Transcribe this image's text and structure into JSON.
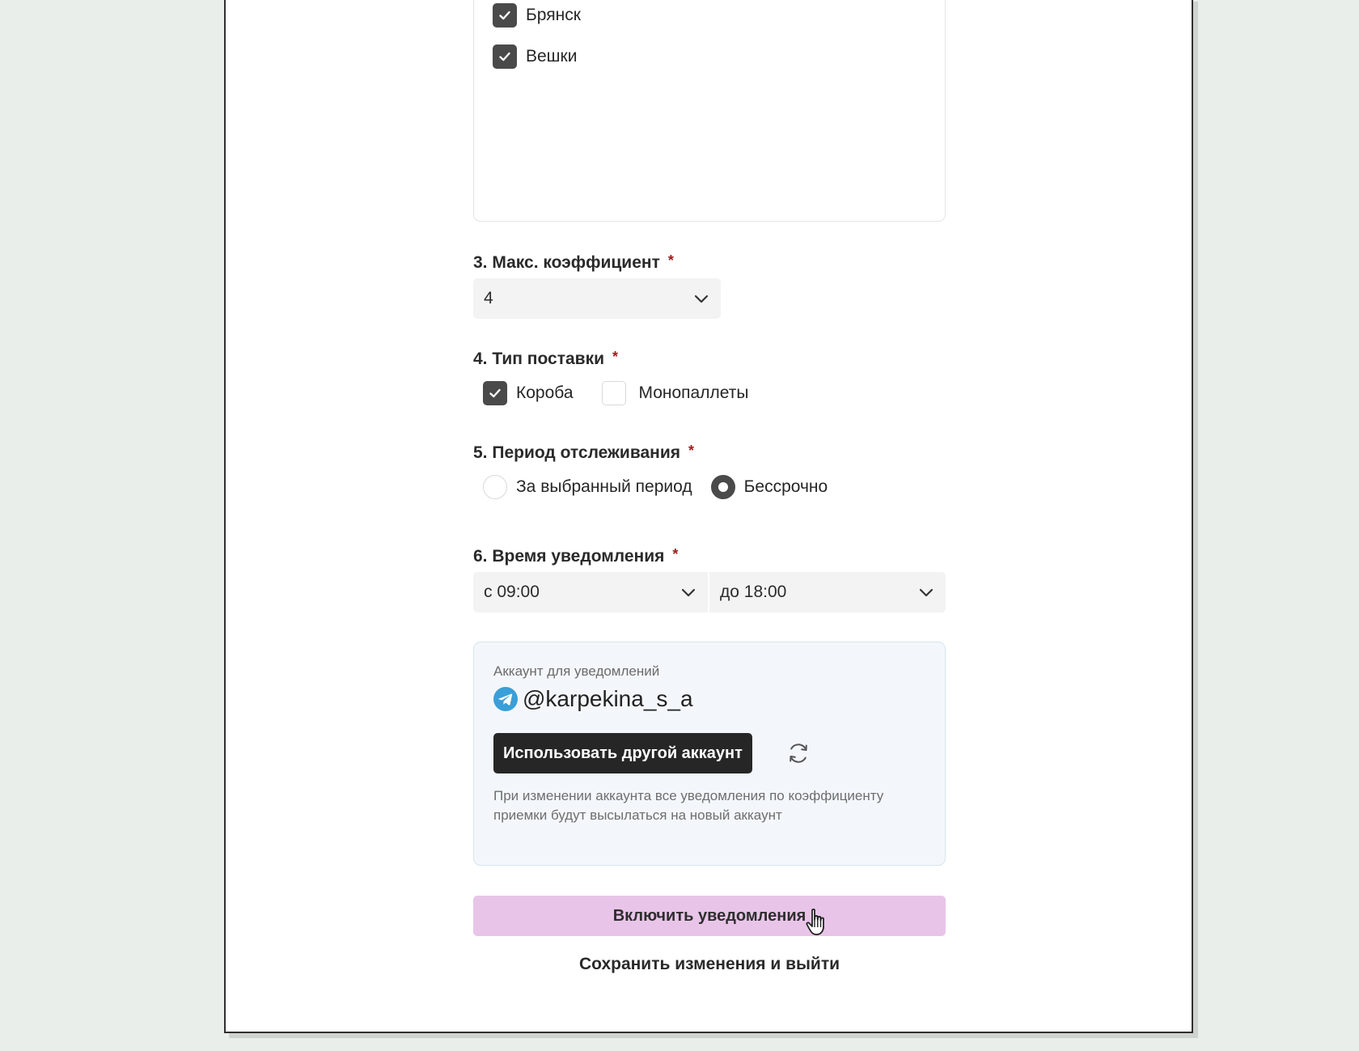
{
  "regions": {
    "items": [
      {
        "label": "Брянск",
        "checked": true
      },
      {
        "label": "Вешки",
        "checked": true
      }
    ]
  },
  "coefficient": {
    "label": "3. Макс. коэффициент",
    "required_mark": "*",
    "value": "4"
  },
  "supply_type": {
    "label": "4. Тип поставки",
    "required_mark": "*",
    "options": [
      {
        "label": "Короба",
        "checked": true
      },
      {
        "label": "Монопаллеты",
        "checked": false
      }
    ]
  },
  "tracking_period": {
    "label": "5. Период отслеживания",
    "required_mark": "*",
    "options": [
      {
        "label": "За выбранный период",
        "selected": false
      },
      {
        "label": "Бессрочно",
        "selected": true
      }
    ]
  },
  "notify_time": {
    "label": "6. Время уведомления",
    "required_mark": "*",
    "from": "с 09:00",
    "to": "до 18:00"
  },
  "account": {
    "caption": "Аккаунт для уведомлений",
    "handle": "@karpekina_s_a",
    "change_button": "Использовать другой аккаунт",
    "note": "При изменении аккаунта все уведомления по коэффициенту приемки будут высылаться на новый аккаунт"
  },
  "actions": {
    "enable_button": "Включить уведомления",
    "save_exit": "Сохранить изменения и выйти"
  },
  "colors": {
    "enable_button_bg": "#e8c5e8",
    "primary_dark": "#262626",
    "required": "#a21c1c",
    "telegram": "#3a9fd8"
  }
}
